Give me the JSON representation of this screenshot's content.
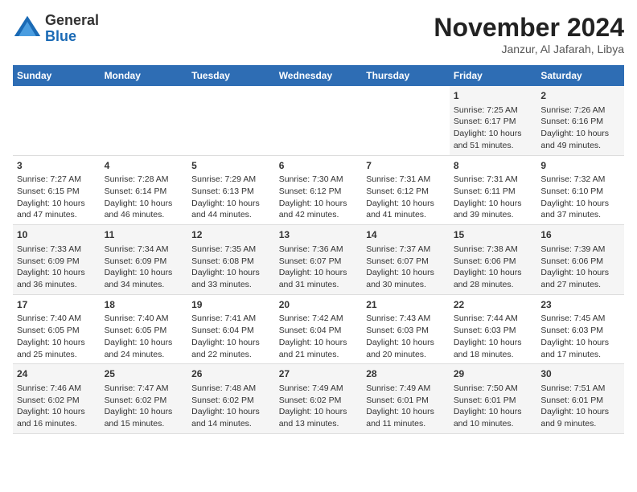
{
  "header": {
    "logo_line1": "General",
    "logo_line2": "Blue",
    "month": "November 2024",
    "location": "Janzur, Al Jafarah, Libya"
  },
  "weekdays": [
    "Sunday",
    "Monday",
    "Tuesday",
    "Wednesday",
    "Thursday",
    "Friday",
    "Saturday"
  ],
  "weeks": [
    [
      {
        "day": "",
        "content": ""
      },
      {
        "day": "",
        "content": ""
      },
      {
        "day": "",
        "content": ""
      },
      {
        "day": "",
        "content": ""
      },
      {
        "day": "",
        "content": ""
      },
      {
        "day": "1",
        "content": "Sunrise: 7:25 AM\nSunset: 6:17 PM\nDaylight: 10 hours\nand 51 minutes."
      },
      {
        "day": "2",
        "content": "Sunrise: 7:26 AM\nSunset: 6:16 PM\nDaylight: 10 hours\nand 49 minutes."
      }
    ],
    [
      {
        "day": "3",
        "content": "Sunrise: 7:27 AM\nSunset: 6:15 PM\nDaylight: 10 hours\nand 47 minutes."
      },
      {
        "day": "4",
        "content": "Sunrise: 7:28 AM\nSunset: 6:14 PM\nDaylight: 10 hours\nand 46 minutes."
      },
      {
        "day": "5",
        "content": "Sunrise: 7:29 AM\nSunset: 6:13 PM\nDaylight: 10 hours\nand 44 minutes."
      },
      {
        "day": "6",
        "content": "Sunrise: 7:30 AM\nSunset: 6:12 PM\nDaylight: 10 hours\nand 42 minutes."
      },
      {
        "day": "7",
        "content": "Sunrise: 7:31 AM\nSunset: 6:12 PM\nDaylight: 10 hours\nand 41 minutes."
      },
      {
        "day": "8",
        "content": "Sunrise: 7:31 AM\nSunset: 6:11 PM\nDaylight: 10 hours\nand 39 minutes."
      },
      {
        "day": "9",
        "content": "Sunrise: 7:32 AM\nSunset: 6:10 PM\nDaylight: 10 hours\nand 37 minutes."
      }
    ],
    [
      {
        "day": "10",
        "content": "Sunrise: 7:33 AM\nSunset: 6:09 PM\nDaylight: 10 hours\nand 36 minutes."
      },
      {
        "day": "11",
        "content": "Sunrise: 7:34 AM\nSunset: 6:09 PM\nDaylight: 10 hours\nand 34 minutes."
      },
      {
        "day": "12",
        "content": "Sunrise: 7:35 AM\nSunset: 6:08 PM\nDaylight: 10 hours\nand 33 minutes."
      },
      {
        "day": "13",
        "content": "Sunrise: 7:36 AM\nSunset: 6:07 PM\nDaylight: 10 hours\nand 31 minutes."
      },
      {
        "day": "14",
        "content": "Sunrise: 7:37 AM\nSunset: 6:07 PM\nDaylight: 10 hours\nand 30 minutes."
      },
      {
        "day": "15",
        "content": "Sunrise: 7:38 AM\nSunset: 6:06 PM\nDaylight: 10 hours\nand 28 minutes."
      },
      {
        "day": "16",
        "content": "Sunrise: 7:39 AM\nSunset: 6:06 PM\nDaylight: 10 hours\nand 27 minutes."
      }
    ],
    [
      {
        "day": "17",
        "content": "Sunrise: 7:40 AM\nSunset: 6:05 PM\nDaylight: 10 hours\nand 25 minutes."
      },
      {
        "day": "18",
        "content": "Sunrise: 7:40 AM\nSunset: 6:05 PM\nDaylight: 10 hours\nand 24 minutes."
      },
      {
        "day": "19",
        "content": "Sunrise: 7:41 AM\nSunset: 6:04 PM\nDaylight: 10 hours\nand 22 minutes."
      },
      {
        "day": "20",
        "content": "Sunrise: 7:42 AM\nSunset: 6:04 PM\nDaylight: 10 hours\nand 21 minutes."
      },
      {
        "day": "21",
        "content": "Sunrise: 7:43 AM\nSunset: 6:03 PM\nDaylight: 10 hours\nand 20 minutes."
      },
      {
        "day": "22",
        "content": "Sunrise: 7:44 AM\nSunset: 6:03 PM\nDaylight: 10 hours\nand 18 minutes."
      },
      {
        "day": "23",
        "content": "Sunrise: 7:45 AM\nSunset: 6:03 PM\nDaylight: 10 hours\nand 17 minutes."
      }
    ],
    [
      {
        "day": "24",
        "content": "Sunrise: 7:46 AM\nSunset: 6:02 PM\nDaylight: 10 hours\nand 16 minutes."
      },
      {
        "day": "25",
        "content": "Sunrise: 7:47 AM\nSunset: 6:02 PM\nDaylight: 10 hours\nand 15 minutes."
      },
      {
        "day": "26",
        "content": "Sunrise: 7:48 AM\nSunset: 6:02 PM\nDaylight: 10 hours\nand 14 minutes."
      },
      {
        "day": "27",
        "content": "Sunrise: 7:49 AM\nSunset: 6:02 PM\nDaylight: 10 hours\nand 13 minutes."
      },
      {
        "day": "28",
        "content": "Sunrise: 7:49 AM\nSunset: 6:01 PM\nDaylight: 10 hours\nand 11 minutes."
      },
      {
        "day": "29",
        "content": "Sunrise: 7:50 AM\nSunset: 6:01 PM\nDaylight: 10 hours\nand 10 minutes."
      },
      {
        "day": "30",
        "content": "Sunrise: 7:51 AM\nSunset: 6:01 PM\nDaylight: 10 hours\nand 9 minutes."
      }
    ]
  ]
}
